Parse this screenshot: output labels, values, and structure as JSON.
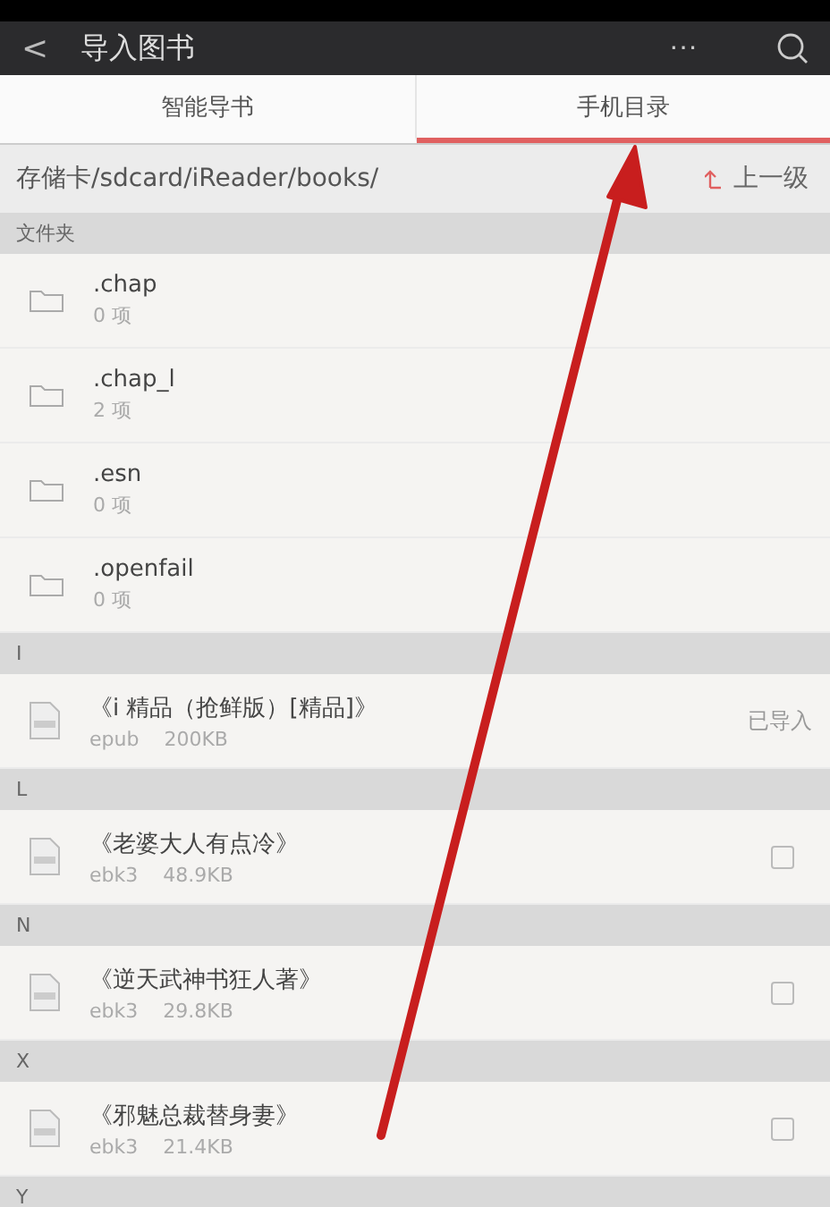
{
  "header": {
    "back": "<",
    "title": "导入图书",
    "more": "···"
  },
  "tabs": [
    {
      "label": "智能导书",
      "selected": false
    },
    {
      "label": "手机目录",
      "selected": true
    }
  ],
  "path_bar": {
    "path": "存储卡/sdcard/iReader/books/",
    "up_label": "上一级"
  },
  "sections": [
    {
      "label": "文件夹",
      "items": [
        {
          "kind": "folder",
          "name": ".chap",
          "count": "0 项"
        },
        {
          "kind": "folder",
          "name": ".chap_l",
          "count": "2 项"
        },
        {
          "kind": "folder",
          "name": ".esn",
          "count": "0 项"
        },
        {
          "kind": "folder",
          "name": ".openfail",
          "count": "0 项"
        }
      ]
    },
    {
      "label": "I",
      "items": [
        {
          "kind": "book",
          "name": "《i 精品（抢鲜版）[精品]》",
          "format": "epub",
          "size": "200KB",
          "status": "已导入"
        }
      ]
    },
    {
      "label": "L",
      "items": [
        {
          "kind": "book",
          "name": "《老婆大人有点冷》",
          "format": "ebk3",
          "size": "48.9KB",
          "checked": false
        }
      ]
    },
    {
      "label": "N",
      "items": [
        {
          "kind": "book",
          "name": "《逆天武神书狂人著》",
          "format": "ebk3",
          "size": "29.8KB",
          "checked": false
        }
      ]
    },
    {
      "label": "X",
      "items": [
        {
          "kind": "book",
          "name": "《邪魅总裁替身妻》",
          "format": "ebk3",
          "size": "21.4KB",
          "checked": false
        }
      ]
    },
    {
      "label": "Y"
    }
  ]
}
